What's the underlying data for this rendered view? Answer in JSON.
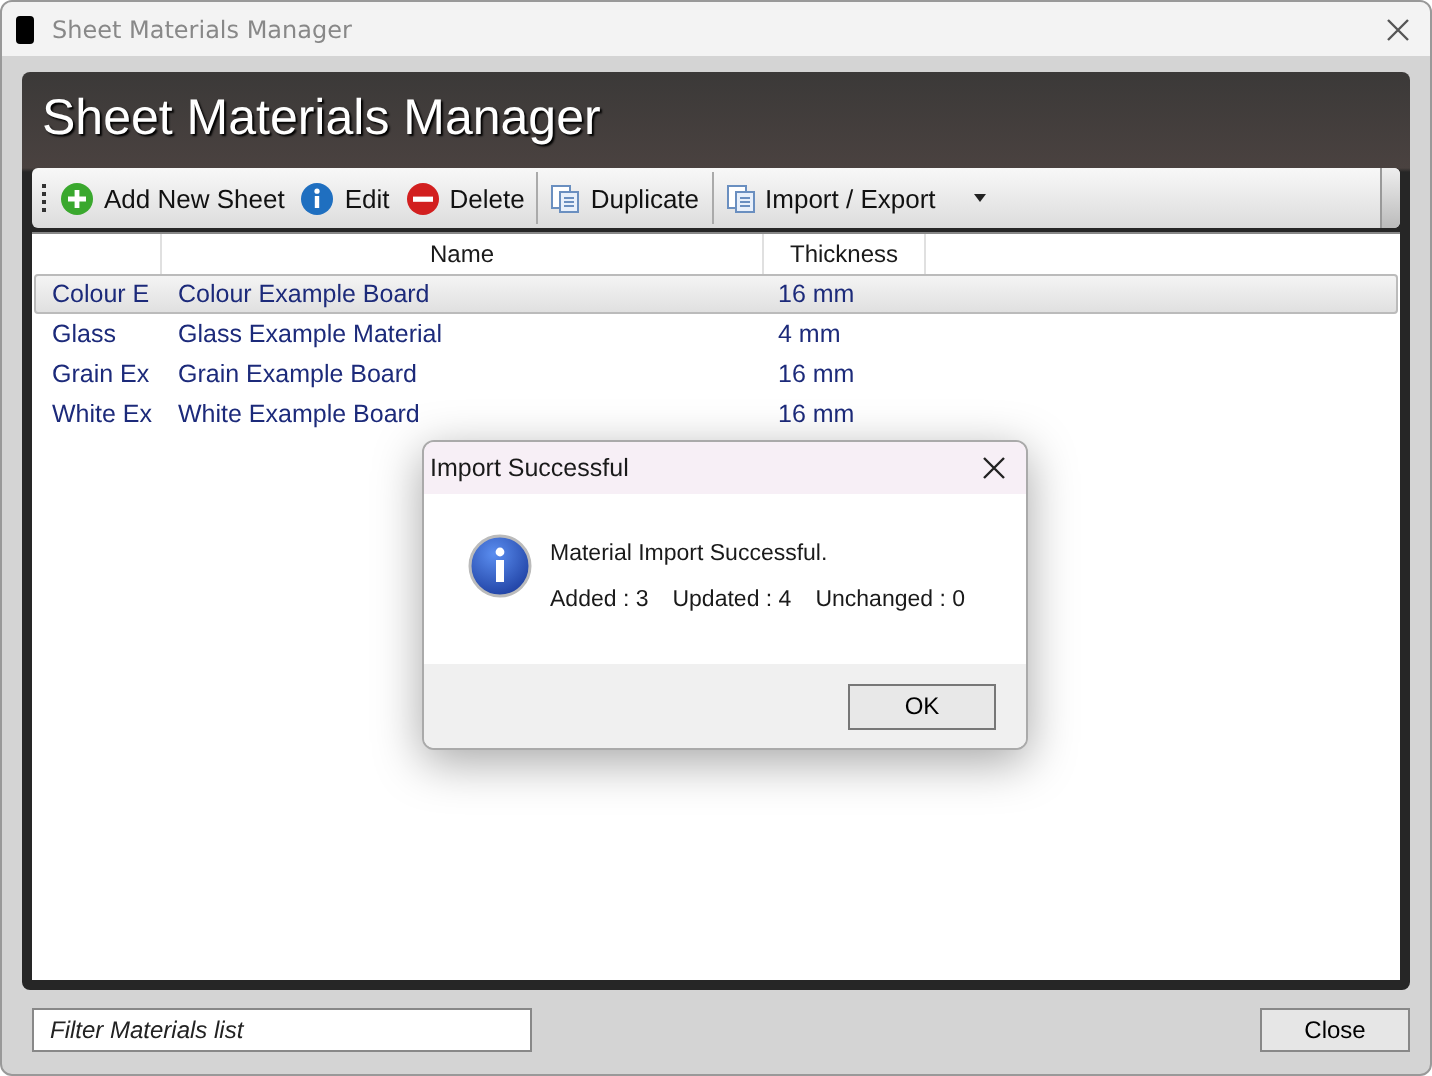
{
  "window": {
    "title": "Sheet Materials Manager"
  },
  "header": {
    "title": "Sheet Materials Manager"
  },
  "toolbar": [
    {
      "label": "Add New Sheet",
      "kind": "add"
    },
    {
      "label": "Edit",
      "kind": "edit"
    },
    {
      "label": "Delete",
      "kind": "delete"
    },
    {
      "label": "Duplicate",
      "kind": "duplicate"
    },
    {
      "label": "Import / Export",
      "kind": "menu"
    }
  ],
  "table": {
    "columns": [
      "",
      "Name",
      "Thickness"
    ],
    "rows": [
      {
        "cells": [
          "Colour E",
          "Colour Example Board",
          "16 mm"
        ],
        "selected": true
      },
      {
        "cells": [
          "Glass",
          "Glass Example Material",
          "4 mm"
        ],
        "selected": false
      },
      {
        "cells": [
          "Grain Ex",
          "Grain Example Board",
          "16 mm"
        ],
        "selected": false
      },
      {
        "cells": [
          "White Ex",
          "White Example Board",
          "16 mm"
        ],
        "selected": false
      }
    ]
  },
  "filter": {
    "placeholder": "Filter Materials list"
  },
  "close_button": "Close",
  "dialog": {
    "title": "Import Successful",
    "message": "Material Import Successful.",
    "stats": [
      "Added : 3",
      "Updated : 4",
      "Unchanged : 0"
    ],
    "button": "OK"
  }
}
